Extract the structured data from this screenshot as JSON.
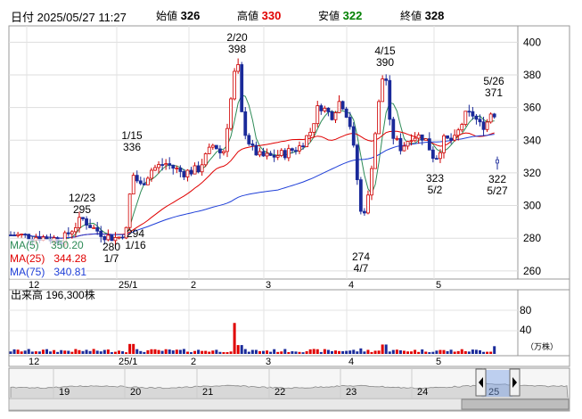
{
  "header": {
    "date_label": "日付",
    "date_value": "2025/05/27 11:27",
    "open_label": "始値",
    "open_value": "326",
    "high_label": "高値",
    "high_value": "330",
    "low_label": "安値",
    "low_value": "322",
    "close_label": "終値",
    "close_value": "328",
    "colors": {
      "high": "#e00000",
      "low": "#008000",
      "text": "#000000"
    }
  },
  "legend": {
    "ma5_label": "MA(5)",
    "ma5_value": "350.20",
    "ma5_color": "#2e8b57",
    "ma25_label": "MA(25)",
    "ma25_value": "344.28",
    "ma25_color": "#e00000",
    "ma75_label": "MA(75)",
    "ma75_value": "340.81",
    "ma75_color": "#1f3fd8"
  },
  "volume": {
    "title": "出来高  196,300株",
    "unit": "（万株）",
    "y_ticks": [
      "80",
      "40"
    ]
  },
  "price_axis": {
    "ticks": [
      "400",
      "380",
      "360",
      "340",
      "320",
      "300",
      "280",
      "260"
    ]
  },
  "x_axis": {
    "ticks": [
      "12",
      "25/1",
      "2",
      "3",
      "4",
      "5"
    ]
  },
  "annotations": [
    {
      "date": "2/20",
      "price": "398"
    },
    {
      "date": "4/15",
      "price": "390"
    },
    {
      "date": "5/26",
      "price": "371"
    },
    {
      "date": "1/15",
      "price": "336"
    },
    {
      "date": "12/23",
      "price": "295"
    },
    {
      "date": "1/16",
      "price": "294"
    },
    {
      "date": "1/7",
      "price": "280"
    },
    {
      "date": "4/7",
      "price": "274"
    },
    {
      "date": "5/2",
      "price": "323"
    },
    {
      "date": "5/27",
      "price": "322"
    }
  ],
  "navigator": {
    "ticks": [
      "19",
      "20",
      "21",
      "22",
      "23",
      "24",
      "25"
    ]
  },
  "chart_data": {
    "type": "candlestick",
    "ylim": [
      255,
      410
    ],
    "x_categories": [
      "12",
      "25/1",
      "2",
      "3",
      "4",
      "5"
    ],
    "series": [
      {
        "name": "MA(5)",
        "value": "350.20"
      },
      {
        "name": "MA(25)",
        "value": "344.28"
      },
      {
        "name": "MA(75)",
        "value": "340.81"
      }
    ],
    "highs": [
      {
        "date": "2/20",
        "value": 398
      },
      {
        "date": "4/15",
        "value": 390
      },
      {
        "date": "5/26",
        "value": 371
      },
      {
        "date": "1/15",
        "value": 336
      },
      {
        "date": "12/23",
        "value": 295
      }
    ],
    "lows": [
      {
        "date": "1/16",
        "value": 294
      },
      {
        "date": "1/7",
        "value": 280
      },
      {
        "date": "4/7",
        "value": 274
      },
      {
        "date": "5/2",
        "value": 323
      },
      {
        "date": "5/27",
        "value": 322
      }
    ],
    "last": {
      "open": 326,
      "high": 330,
      "low": 322,
      "close": 328
    }
  }
}
